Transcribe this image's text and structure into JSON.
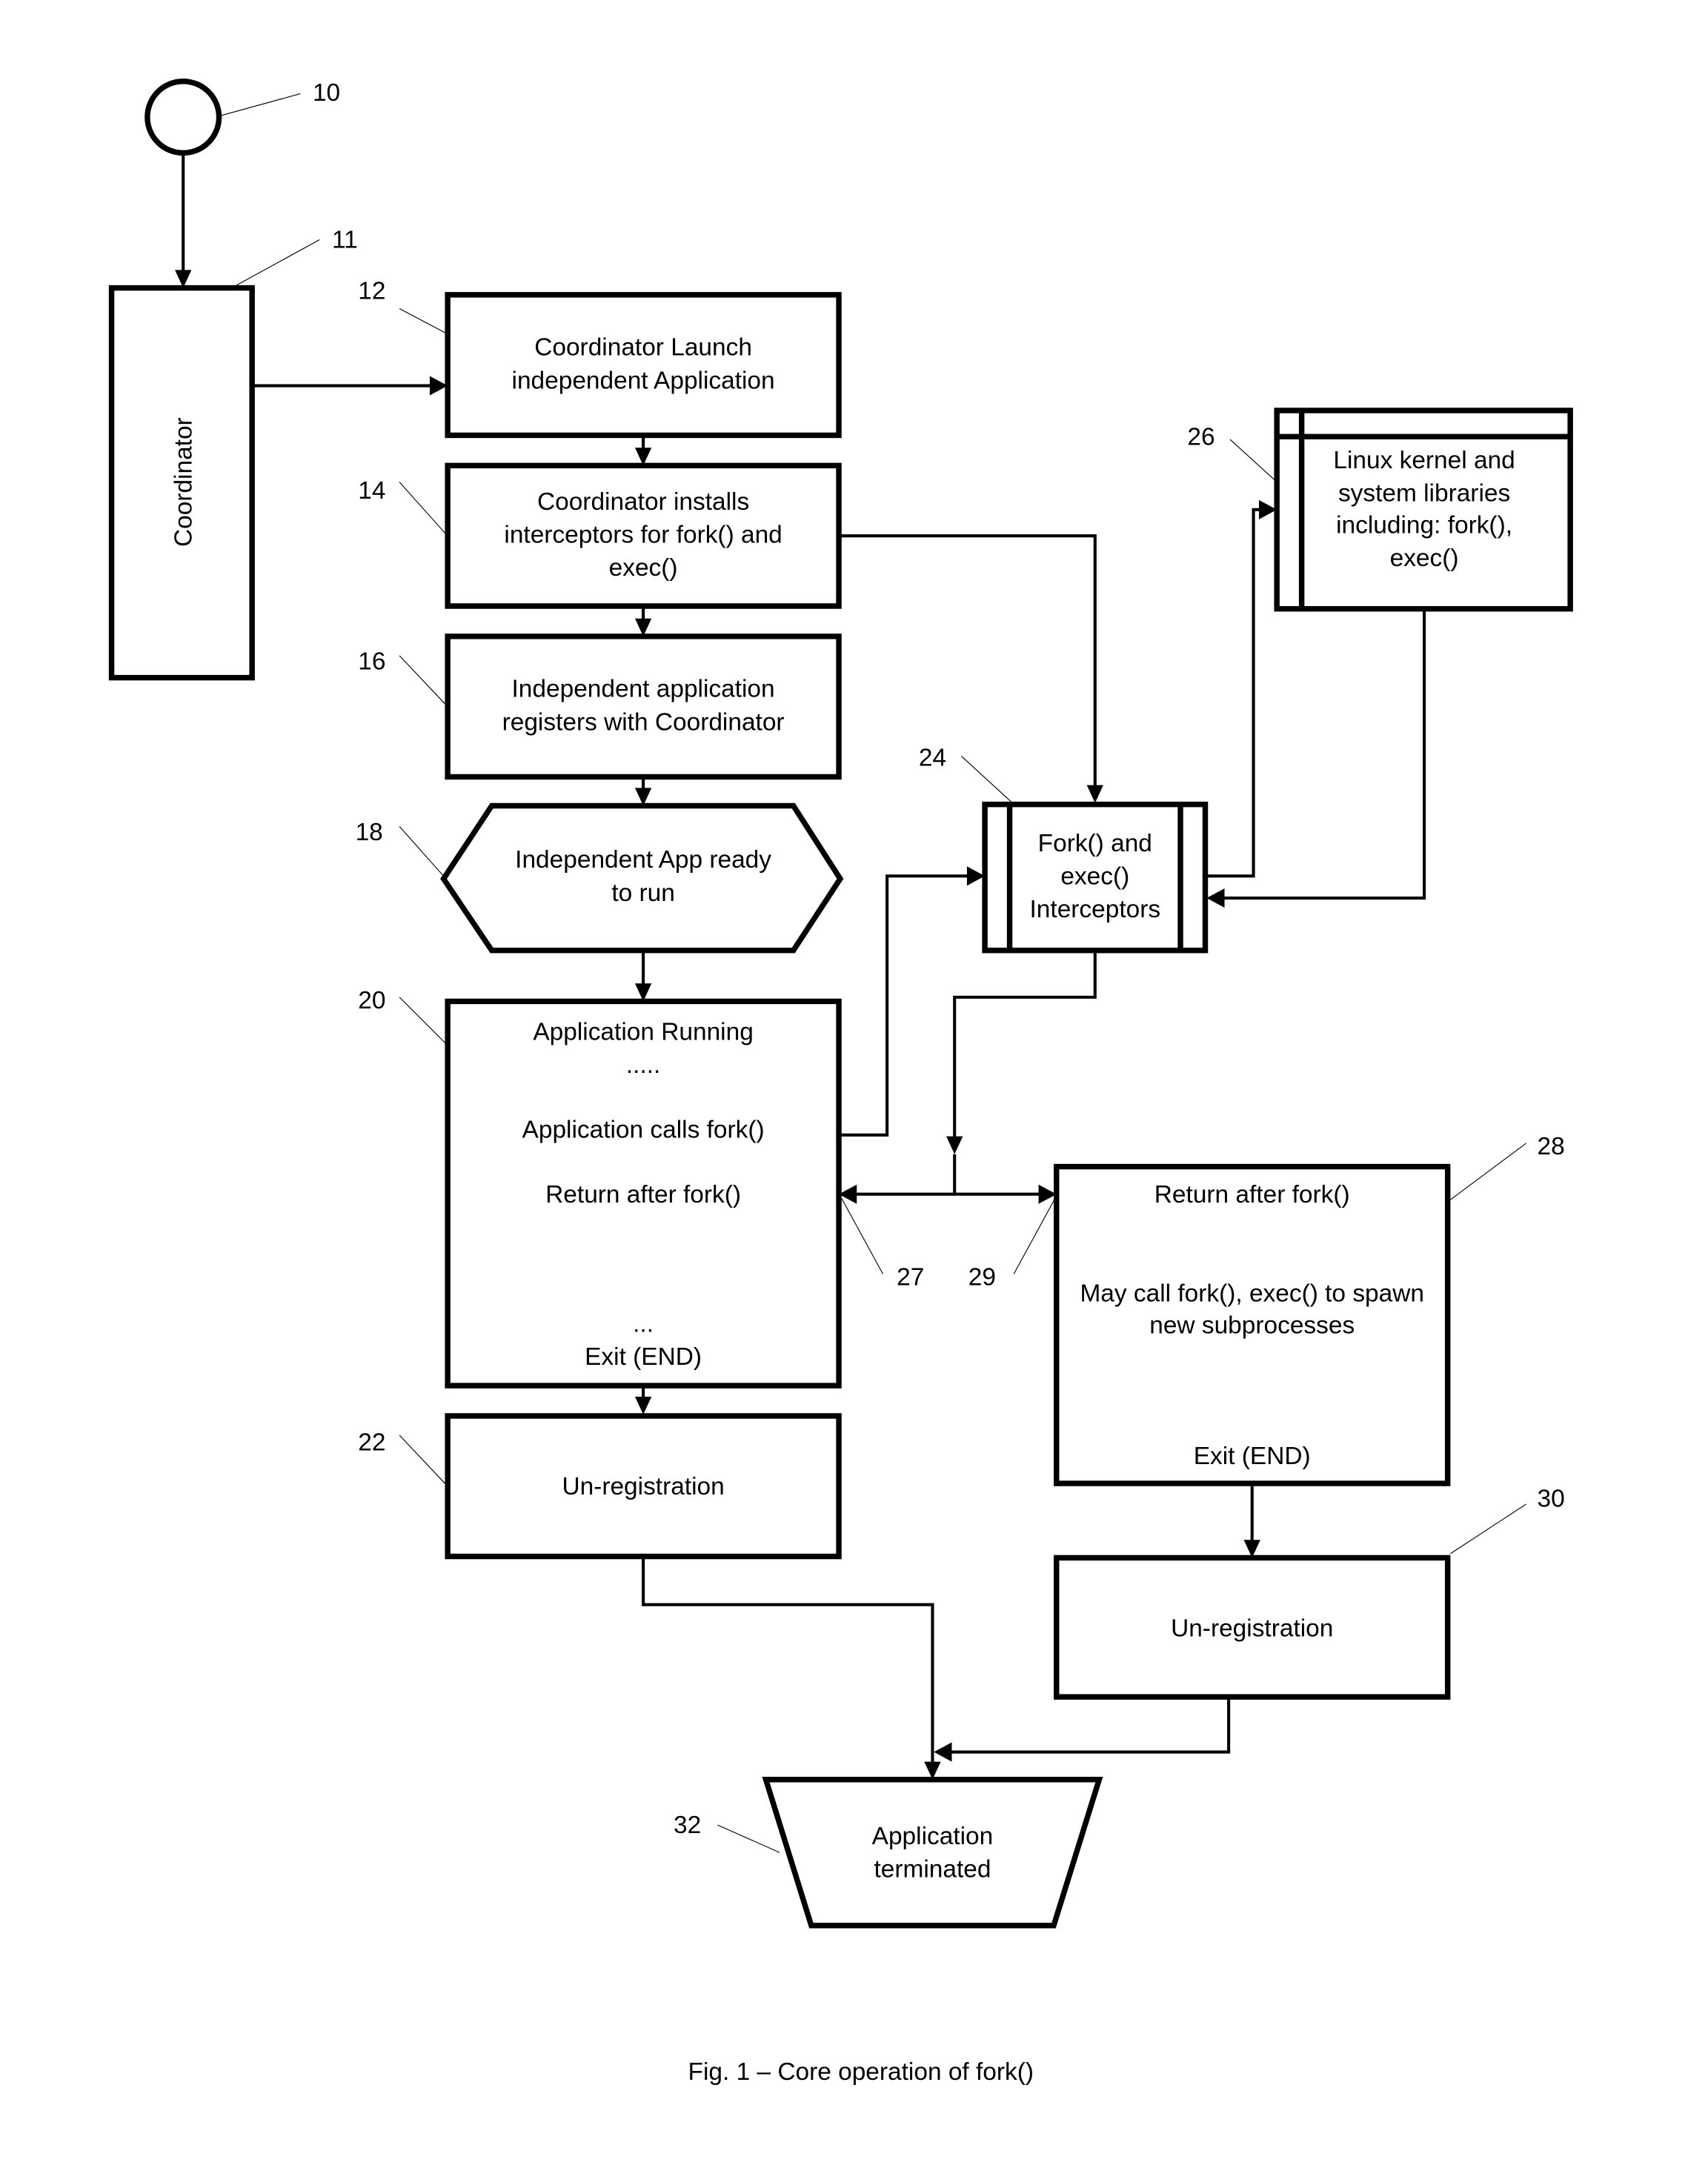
{
  "figure": {
    "caption": "Fig. 1 – Core operation of fork()"
  },
  "nodes": {
    "start": {
      "ref": "10"
    },
    "coordinator": {
      "ref": "11",
      "label": "Coordinator"
    },
    "launch": {
      "ref": "12",
      "lines": [
        "Coordinator Launch",
        "independent Application"
      ]
    },
    "install": {
      "ref": "14",
      "lines": [
        "Coordinator installs",
        "interceptors for fork() and",
        "exec()"
      ]
    },
    "register": {
      "ref": "16",
      "lines": [
        "Independent application",
        "registers with Coordinator"
      ]
    },
    "ready": {
      "ref": "18",
      "lines": [
        "Independent App ready",
        "to run"
      ]
    },
    "running": {
      "ref": "20",
      "lines": [
        "Application Running",
        ".....",
        "Application calls fork()",
        "Return after fork()",
        "...",
        "Exit (END)"
      ]
    },
    "unregister_parent": {
      "ref": "22",
      "lines": [
        "Un-registration"
      ]
    },
    "interceptors": {
      "ref": "24",
      "lines": [
        "Fork() and",
        "exec()",
        "Interceptors"
      ]
    },
    "kernel": {
      "ref": "26",
      "lines": [
        "Linux kernel and",
        "system libraries",
        "including: fork(),",
        "exec()"
      ]
    },
    "child": {
      "ref": "28",
      "lines": [
        "Return after fork()",
        "May call fork(), exec() to spawn",
        "new subprocesses",
        "Exit (END)"
      ]
    },
    "unregister_child": {
      "ref": "30",
      "lines": [
        "Un-registration"
      ]
    },
    "terminated": {
      "ref": "32",
      "lines": [
        "Application",
        "terminated"
      ]
    }
  },
  "connectors": {
    "return_parent": {
      "ref": "27"
    },
    "return_child": {
      "ref": "29"
    }
  }
}
